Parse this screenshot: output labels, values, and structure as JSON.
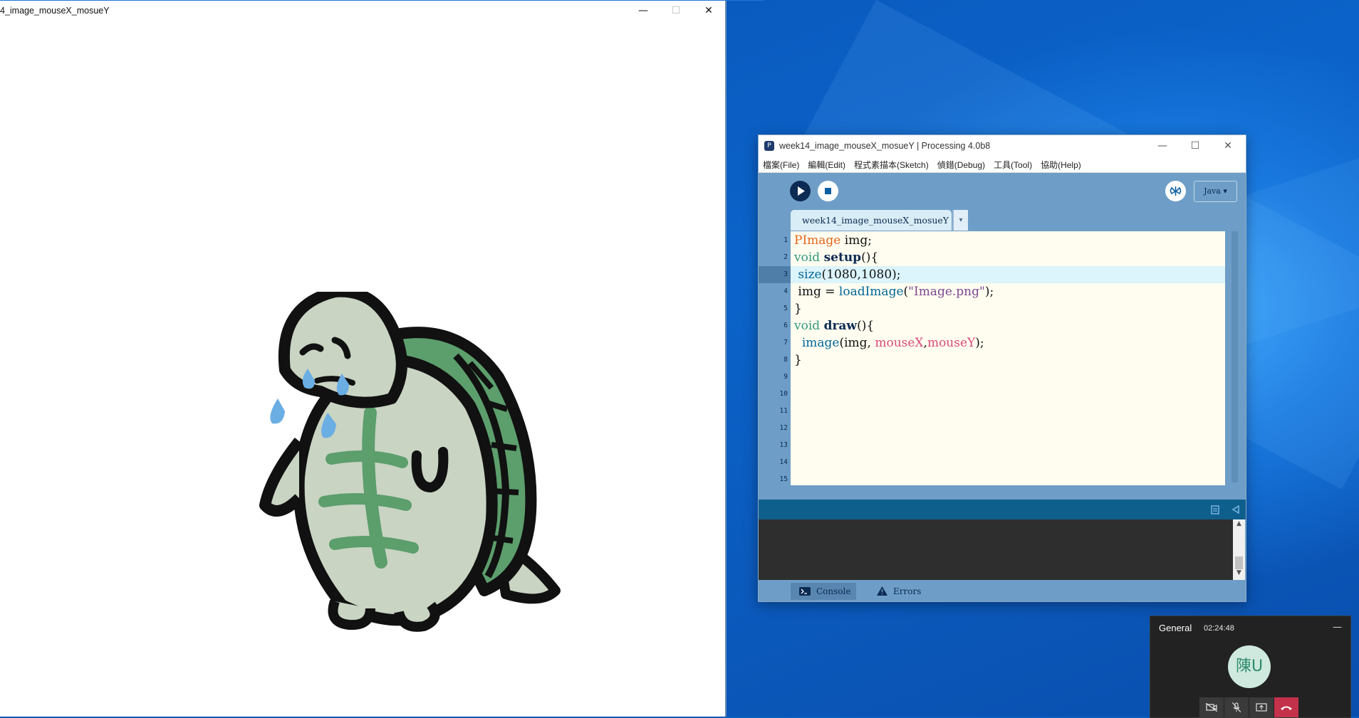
{
  "sketch_window": {
    "title": "4_image_mouseX_mosueY",
    "controls": {
      "minimize": "—",
      "maximize": "☐",
      "close": "✕"
    }
  },
  "ide": {
    "title": "week14_image_mouseX_mosueY | Processing 4.0b8",
    "menu": [
      "檔案(File)",
      "編輯(Edit)",
      "程式素描本(Sketch)",
      "偵錯(Debug)",
      "工具(Tool)",
      "協助(Help)"
    ],
    "mode": "Java ▾",
    "tab_name": "week14_image_mouseX_mosueY",
    "tab_menu_icon": "▾",
    "line_numbers": [
      "1",
      "2",
      "3",
      "4",
      "5",
      "6",
      "7",
      "8",
      "9",
      "10",
      "11",
      "12",
      "13",
      "14",
      "15"
    ],
    "active_line": 3,
    "bottom_tabs": {
      "console": "Console",
      "errors": "Errors"
    },
    "colors": {
      "accent": "#6e9ec7",
      "status_bar": "#0f5f8d",
      "editor_bg": "#fffdf0",
      "highlight": "#dcf4fb"
    }
  },
  "code": {
    "l1": {
      "type": "PImage",
      "rest": " img;"
    },
    "l2": {
      "void": "void",
      "fn": "setup",
      "rest": "(){"
    },
    "l3": {
      "fn": " size",
      "rest": "(1080,1080);"
    },
    "l4": {
      "a": " img = ",
      "fn": "loadImage",
      "b": "(",
      "str": "\"Image.png\"",
      "c": ");"
    },
    "l5": {
      "text": "}"
    },
    "l6": {
      "void": "void",
      "fn": "draw",
      "rest": "(){"
    },
    "l7": {
      "a": "  ",
      "fn": "image",
      "b": "(img, ",
      "v1": "mouseX",
      "comma": ",",
      "v2": "mouseY",
      "c": ");"
    },
    "l8": {
      "text": "}"
    }
  },
  "call": {
    "channel": "General",
    "timer": "02:24:48",
    "avatar_text": "陳U",
    "minimize": "—"
  }
}
